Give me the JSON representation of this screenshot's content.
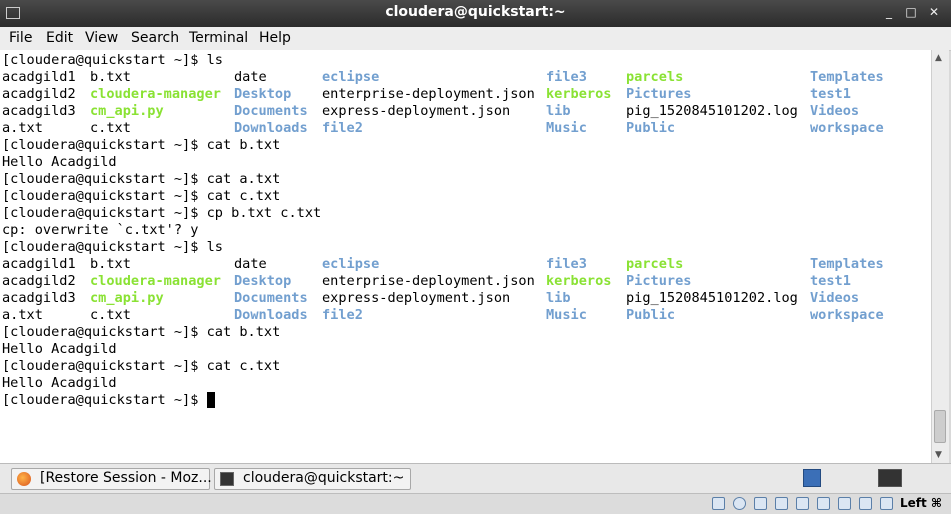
{
  "window": {
    "title": "cloudera@quickstart:~",
    "buttons": {
      "minimize": "_",
      "maximize": "□",
      "close": "✕"
    }
  },
  "menu": [
    "File",
    "Edit",
    "View",
    "Search",
    "Terminal",
    "Help"
  ],
  "prompt": "[cloudera@quickstart ~]$ ",
  "terminal": [
    {
      "type": "cmd",
      "text": "ls"
    },
    {
      "type": "ls",
      "cells": [
        {
          "t": "acadgild1",
          "c": "plain"
        },
        {
          "t": "b.txt",
          "c": "plain"
        },
        {
          "t": "date",
          "c": "plain"
        },
        {
          "t": "eclipse",
          "c": "dir"
        },
        {
          "t": "file3",
          "c": "dir"
        },
        {
          "t": "parcels",
          "c": "exe"
        },
        {
          "t": "Templates",
          "c": "dir"
        }
      ]
    },
    {
      "type": "ls",
      "cells": [
        {
          "t": "acadgild2",
          "c": "plain"
        },
        {
          "t": "cloudera-manager",
          "c": "exe"
        },
        {
          "t": "Desktop",
          "c": "dir"
        },
        {
          "t": "enterprise-deployment.json",
          "c": "plain"
        },
        {
          "t": "kerberos",
          "c": "exe"
        },
        {
          "t": "Pictures",
          "c": "dir"
        },
        {
          "t": "test1",
          "c": "dir"
        }
      ]
    },
    {
      "type": "ls",
      "cells": [
        {
          "t": "acadgild3",
          "c": "plain"
        },
        {
          "t": "cm_api.py",
          "c": "exe"
        },
        {
          "t": "Documents",
          "c": "dir"
        },
        {
          "t": "express-deployment.json",
          "c": "plain"
        },
        {
          "t": "lib",
          "c": "dir"
        },
        {
          "t": "pig_1520845101202.log",
          "c": "plain"
        },
        {
          "t": "Videos",
          "c": "dir"
        }
      ]
    },
    {
      "type": "ls",
      "cells": [
        {
          "t": "a.txt",
          "c": "plain"
        },
        {
          "t": "c.txt",
          "c": "plain"
        },
        {
          "t": "Downloads",
          "c": "dir"
        },
        {
          "t": "file2",
          "c": "dir"
        },
        {
          "t": "Music",
          "c": "dir"
        },
        {
          "t": "Public",
          "c": "dir"
        },
        {
          "t": "workspace",
          "c": "dir"
        }
      ]
    },
    {
      "type": "cmd",
      "text": "cat b.txt"
    },
    {
      "type": "out",
      "text": "Hello Acadgild"
    },
    {
      "type": "cmd",
      "text": "cat a.txt"
    },
    {
      "type": "cmd",
      "text": "cat c.txt"
    },
    {
      "type": "cmd",
      "text": "cp b.txt c.txt"
    },
    {
      "type": "out",
      "text": "cp: overwrite `c.txt'? y"
    },
    {
      "type": "cmd",
      "text": "ls"
    },
    {
      "type": "ls",
      "cells": [
        {
          "t": "acadgild1",
          "c": "plain"
        },
        {
          "t": "b.txt",
          "c": "plain"
        },
        {
          "t": "date",
          "c": "plain"
        },
        {
          "t": "eclipse",
          "c": "dir"
        },
        {
          "t": "file3",
          "c": "dir"
        },
        {
          "t": "parcels",
          "c": "exe"
        },
        {
          "t": "Templates",
          "c": "dir"
        }
      ]
    },
    {
      "type": "ls",
      "cells": [
        {
          "t": "acadgild2",
          "c": "plain"
        },
        {
          "t": "cloudera-manager",
          "c": "exe"
        },
        {
          "t": "Desktop",
          "c": "dir"
        },
        {
          "t": "enterprise-deployment.json",
          "c": "plain"
        },
        {
          "t": "kerberos",
          "c": "exe"
        },
        {
          "t": "Pictures",
          "c": "dir"
        },
        {
          "t": "test1",
          "c": "dir"
        }
      ]
    },
    {
      "type": "ls",
      "cells": [
        {
          "t": "acadgild3",
          "c": "plain"
        },
        {
          "t": "cm_api.py",
          "c": "exe"
        },
        {
          "t": "Documents",
          "c": "dir"
        },
        {
          "t": "express-deployment.json",
          "c": "plain"
        },
        {
          "t": "lib",
          "c": "dir"
        },
        {
          "t": "pig_1520845101202.log",
          "c": "plain"
        },
        {
          "t": "Videos",
          "c": "dir"
        }
      ]
    },
    {
      "type": "ls",
      "cells": [
        {
          "t": "a.txt",
          "c": "plain"
        },
        {
          "t": "c.txt",
          "c": "plain"
        },
        {
          "t": "Downloads",
          "c": "dir"
        },
        {
          "t": "file2",
          "c": "dir"
        },
        {
          "t": "Music",
          "c": "dir"
        },
        {
          "t": "Public",
          "c": "dir"
        },
        {
          "t": "workspace",
          "c": "dir"
        }
      ]
    },
    {
      "type": "cmd",
      "text": "cat b.txt"
    },
    {
      "type": "out",
      "text": "Hello Acadgild"
    },
    {
      "type": "cmd",
      "text": "cat c.txt"
    },
    {
      "type": "out",
      "text": "Hello Acadgild"
    },
    {
      "type": "cursor"
    }
  ],
  "colors": {
    "dir": "#729fcf",
    "exe": "#8ae234",
    "text": "#000000",
    "background": "#ffffff"
  },
  "taskbar": {
    "tasks": [
      {
        "label": "[Restore Session - Moz...",
        "icon": "firefox-icon"
      },
      {
        "label": "cloudera@quickstart:~",
        "icon": "terminal-icon"
      }
    ]
  },
  "statusbar": {
    "host_key": "Left ⌘"
  }
}
